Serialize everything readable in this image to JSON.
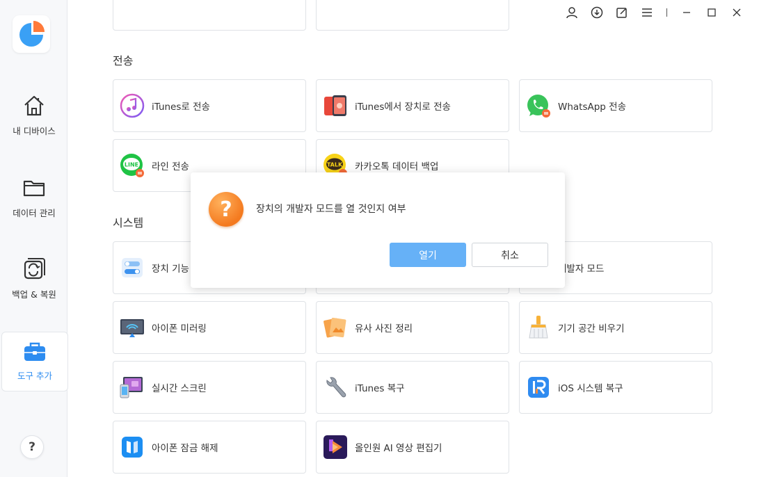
{
  "sidebar": {
    "items": [
      {
        "label": "내 디바이스",
        "icon": "home-icon"
      },
      {
        "label": "데이터 관리",
        "icon": "folder-icon"
      },
      {
        "label": "백업 & 복원",
        "icon": "backup-restore-icon"
      },
      {
        "label": "도구 추가",
        "icon": "toolbox-icon",
        "active": true
      }
    ],
    "help_label": "?"
  },
  "colors": {
    "accent": "#2d8cf0",
    "primary_button": "#66b1f7",
    "warning": "#f47a1f"
  },
  "sections": {
    "transfer": {
      "title": "전송",
      "cards": [
        {
          "label": "iTunes로 전송",
          "icon": "itunes-icon"
        },
        {
          "label": "iTunes에서 장치로 전송",
          "icon": "itunes-to-device-icon"
        },
        {
          "label": "WhatsApp 전송",
          "icon": "whatsapp-icon"
        },
        {
          "label": "라인 전송",
          "icon": "line-icon"
        },
        {
          "label": "카카오톡 데이터 백업",
          "icon": "kakaotalk-icon"
        }
      ]
    },
    "system": {
      "title": "시스템",
      "cards": [
        {
          "label": "장치 기능",
          "icon": "toggle-settings-icon"
        },
        {
          "label": "개발자 모드",
          "icon": "developer-icon"
        },
        {
          "label": "아이폰 미러링",
          "icon": "screen-mirror-icon"
        },
        {
          "label": "유사 사진 정리",
          "icon": "photos-icon"
        },
        {
          "label": "기기 공간 비우기",
          "icon": "broom-icon"
        },
        {
          "label": "실시간 스크린",
          "icon": "live-screen-icon"
        },
        {
          "label": "iTunes 복구",
          "icon": "wrench-icon"
        },
        {
          "label": "iOS 시스템 복구",
          "icon": "ios-repair-icon"
        },
        {
          "label": "아이폰 잠금 해제",
          "icon": "unlock-icon"
        },
        {
          "label": "올인원 AI 영상 편집기",
          "icon": "video-editor-icon"
        }
      ]
    }
  },
  "dialog": {
    "message": "장치의 개발자 모드를 열 것인지 여부",
    "confirm_label": "열기",
    "cancel_label": "취소",
    "icon": "question-icon"
  }
}
